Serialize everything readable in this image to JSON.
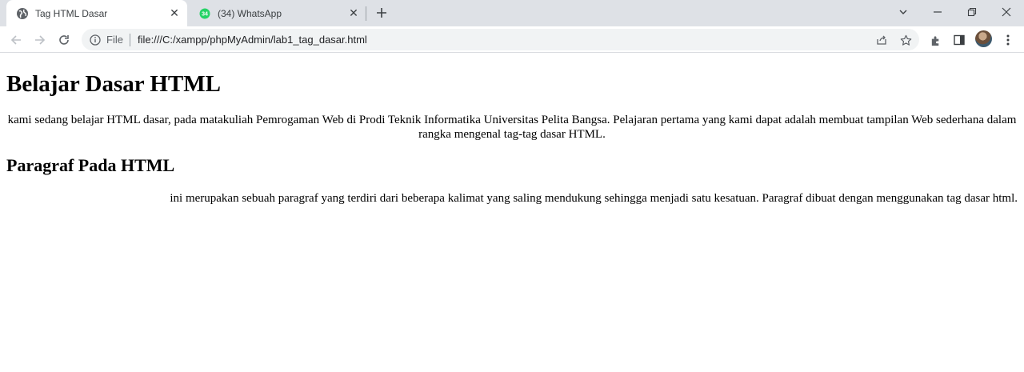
{
  "tabs": [
    {
      "label": "Tag HTML Dasar",
      "icon": "globe-icon",
      "active": true
    },
    {
      "label": "(34) WhatsApp",
      "icon": "whatsapp-icon",
      "badge": "34",
      "active": false
    }
  ],
  "address_bar": {
    "scheme_label": "File",
    "url": "file:///C:/xampp/phpMyAdmin/lab1_tag_dasar.html"
  },
  "page": {
    "heading": "Belajar Dasar HTML",
    "intro_text": "kami sedang belajar HTML dasar, pada matakuliah Pemrogaman Web di Prodi Teknik Informatika Universitas Pelita Bangsa. Pelajaran pertama yang kami dapat adalah membuat tampilan Web sederhana dalam rangka mengenal tag-tag dasar HTML.",
    "subheading": "Paragraf Pada HTML",
    "paragraph_text": "ini merupakan sebuah paragraf yang terdiri dari beberapa kalimat yang saling mendukung sehingga menjadi satu kesatuan. Paragraf dibuat dengan menggunakan tag dasar html."
  },
  "colors": {
    "tabstrip_bg": "#dee1e6",
    "omnibox_bg": "#f1f3f4",
    "whatsapp_green": "#25d366"
  }
}
